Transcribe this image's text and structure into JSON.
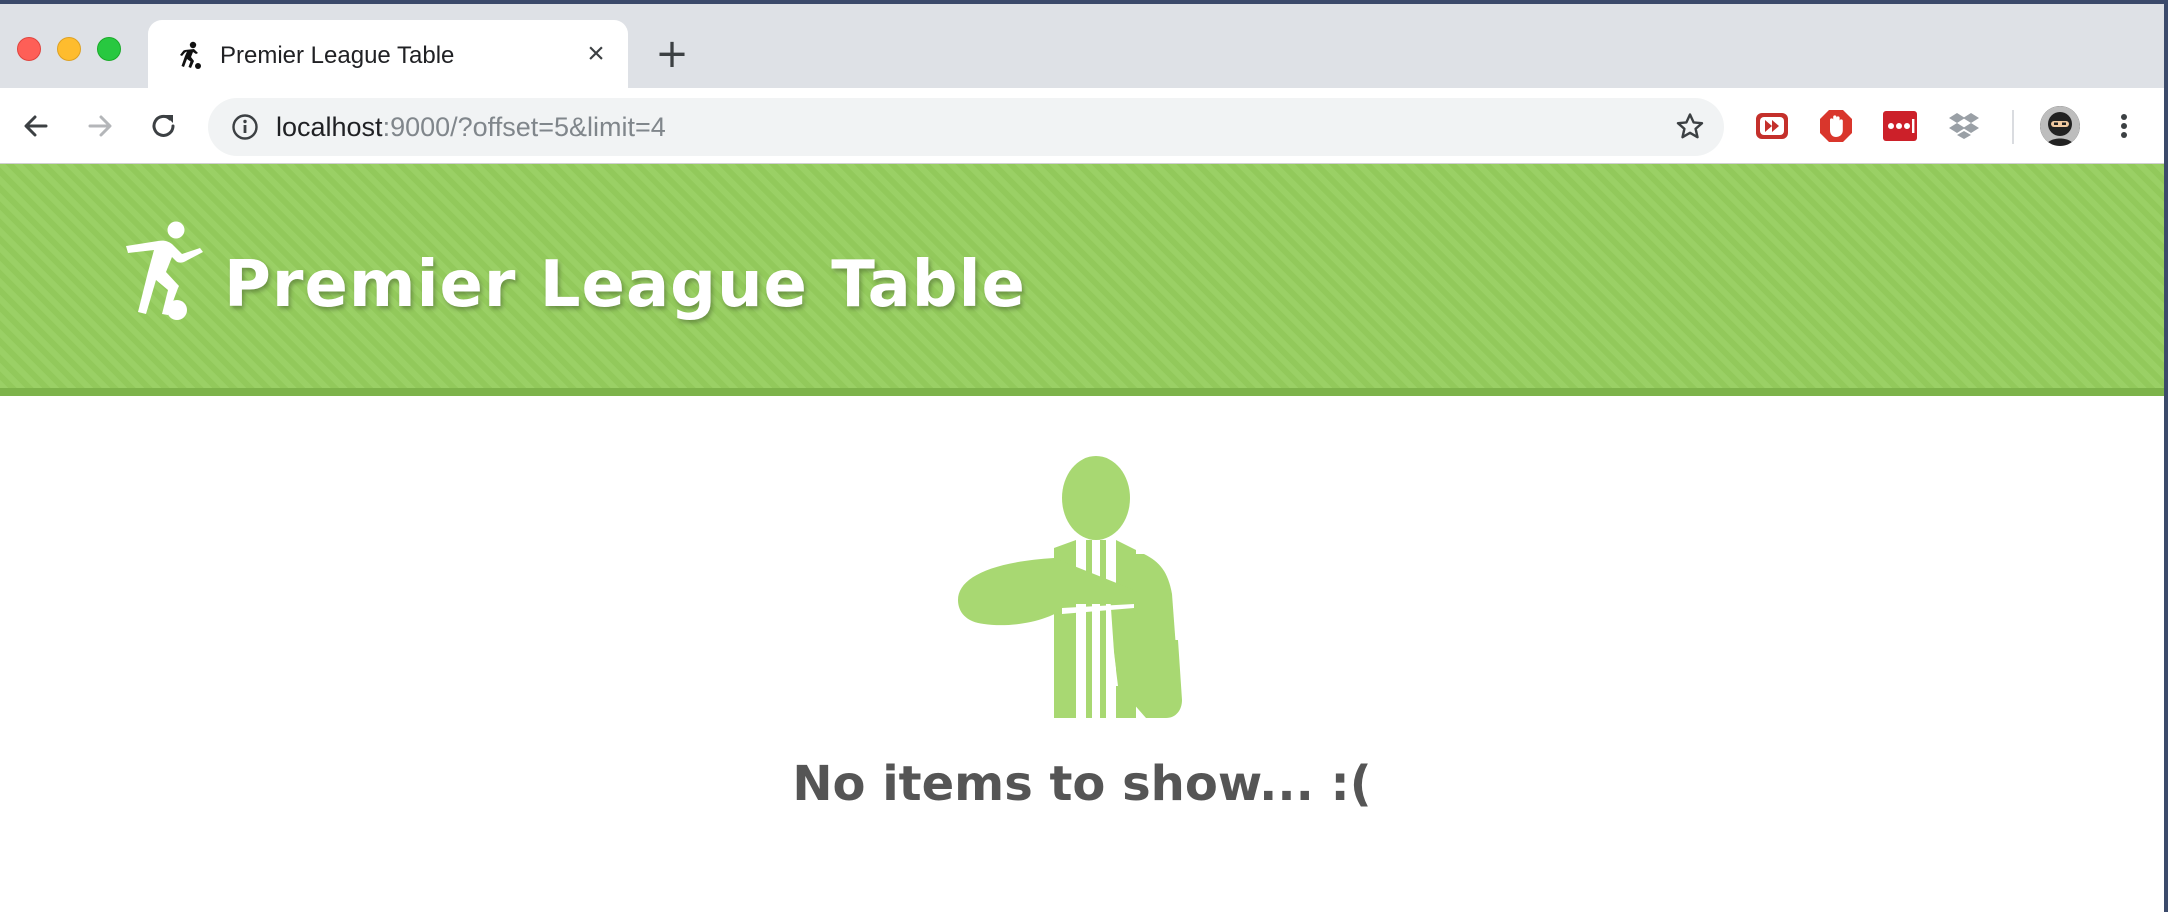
{
  "browser": {
    "tab": {
      "title": "Premier League Table",
      "favicon": "footballer-icon"
    },
    "new_tab_label": "+",
    "close_label": "×",
    "address": {
      "host": "localhost",
      "rest": ":9000/?offset=5&limit=4"
    },
    "extensions": [
      "media-extension-icon",
      "adblock-extension-icon",
      "lastpass-extension-icon",
      "dropbox-extension-icon"
    ]
  },
  "header": {
    "title": "Premier League Table",
    "logo": "footballer-icon"
  },
  "main": {
    "empty_message": "No items to show... :(",
    "illustration": "referee-timeout-icon"
  },
  "colors": {
    "brand_green": "#95cd5d",
    "brand_green_dark": "#7db34a",
    "illustration_green": "#a8d872",
    "message_text": "#555555"
  }
}
